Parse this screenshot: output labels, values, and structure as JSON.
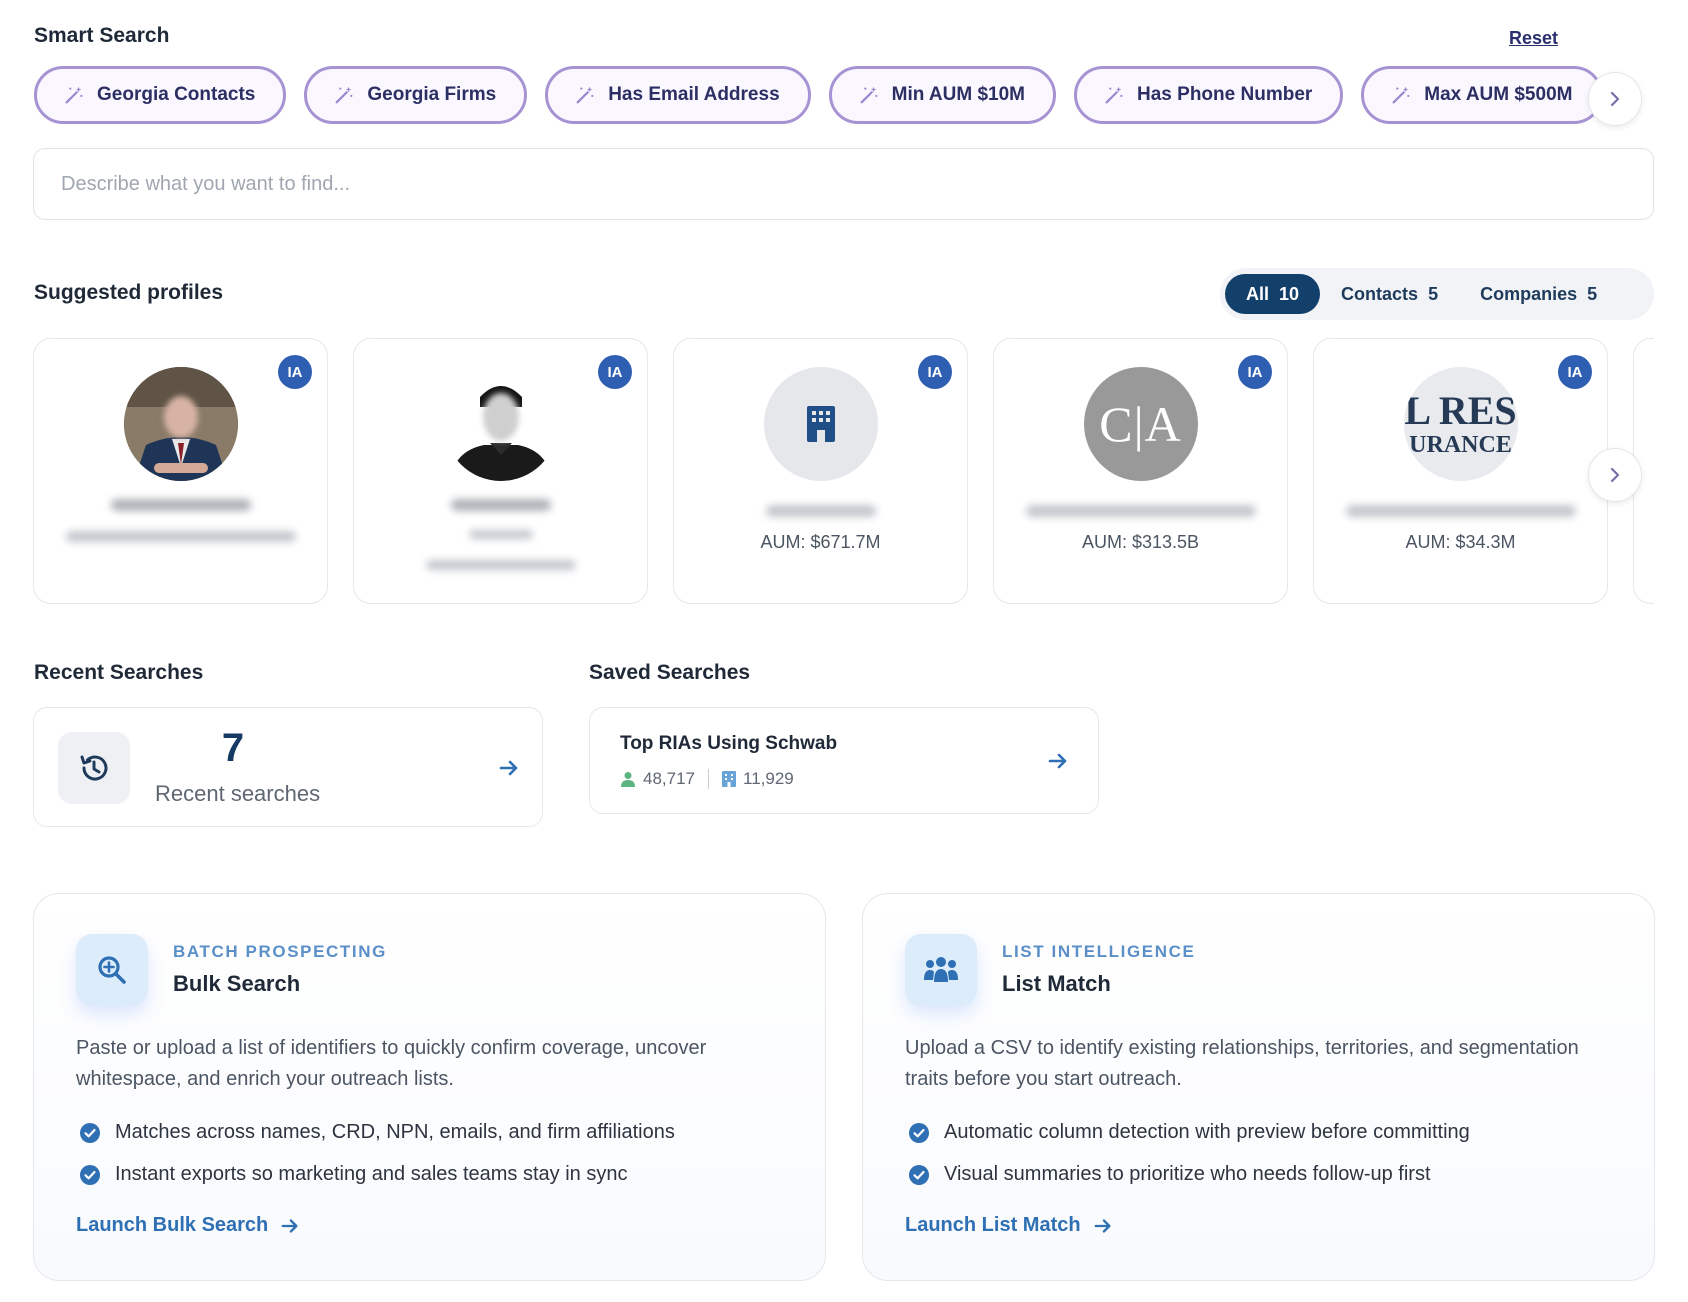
{
  "smart_search": {
    "title": "Smart Search",
    "reset_label": "Reset",
    "chips": [
      "Georgia Contacts",
      "Georgia Firms",
      "Has Email Address",
      "Min AUM $10M",
      "Has Phone Number",
      "Max AUM $500M"
    ],
    "input_placeholder": "Describe what you want to find..."
  },
  "profiles": {
    "title": "Suggested profiles",
    "filters": [
      {
        "label": "All",
        "count": "10"
      },
      {
        "label": "Contacts",
        "count": "5"
      },
      {
        "label": "Companies",
        "count": "5"
      }
    ],
    "badge": "IA",
    "cards": [
      {
        "aum": ""
      },
      {
        "aum": ""
      },
      {
        "aum": "AUM: $671.7M"
      },
      {
        "aum": "AUM: $313.5B",
        "logo_text": "C|A"
      },
      {
        "aum": "AUM: $34.3M",
        "logo_line1": "L RES",
        "logo_line2": "URANCE"
      }
    ]
  },
  "recent": {
    "title": "Recent Searches",
    "count": "7",
    "label": "Recent searches"
  },
  "saved": {
    "title": "Saved Searches",
    "items": [
      {
        "name": "Top RIAs Using Schwab",
        "contacts": "48,717",
        "companies": "11,929"
      }
    ]
  },
  "features": [
    {
      "eyebrow": "BATCH PROSPECTING",
      "title": "Bulk Search",
      "description": "Paste or upload a list of identifiers to quickly confirm coverage, uncover whitespace, and enrich your outreach lists.",
      "bullets": [
        "Matches across names, CRD, NPN, emails, and firm affiliations",
        "Instant exports so marketing and sales teams stay in sync"
      ],
      "link": "Launch Bulk Search"
    },
    {
      "eyebrow": "LIST INTELLIGENCE",
      "title": "List Match",
      "description": "Upload a CSV to identify existing relationships, territories, and segmentation traits before you start outreach.",
      "bullets": [
        "Automatic column detection with preview before committing",
        "Visual summaries to prioritize who needs follow-up first"
      ],
      "link": "Launch List Match"
    }
  ],
  "colors": {
    "chip_border": "#a793d3",
    "active_filter": "#13406b",
    "badge": "#2f5fb3",
    "link": "#2f6fb3"
  },
  "icons": {
    "chip": "magic-wand-icon",
    "recent": "history-icon",
    "bulk": "search-plus-icon",
    "list": "people-group-icon"
  }
}
